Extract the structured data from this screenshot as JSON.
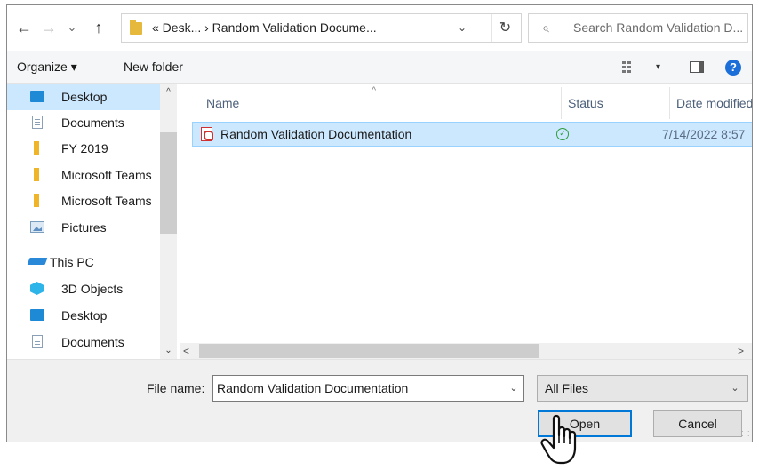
{
  "address": {
    "path": "« Desk... › Random Validation Docume...",
    "back_glyph": "←",
    "forward_glyph": "→",
    "recent_glyph": "⌄",
    "up_glyph": "↑",
    "dropdown_glyph": "⌄",
    "refresh_glyph": "↻"
  },
  "search": {
    "placeholder": "Search Random Validation D...",
    "icon_glyph": "⌕"
  },
  "toolbar": {
    "organize": "Organize ▾",
    "new_folder": "New folder",
    "view_dropdown": "▾",
    "help": "?"
  },
  "nav": {
    "items": [
      {
        "label": "Desktop",
        "icon": "desktop-icon"
      },
      {
        "label": "Documents",
        "icon": "documents-icon"
      },
      {
        "label": "FY 2019",
        "icon": "folder-icon"
      },
      {
        "label": "Microsoft Teams",
        "icon": "folder-icon"
      },
      {
        "label": "Microsoft Teams",
        "icon": "folder-icon"
      },
      {
        "label": "Pictures",
        "icon": "pictures-icon"
      },
      {
        "label": "This PC",
        "icon": "this-pc-icon"
      },
      {
        "label": "3D Objects",
        "icon": "3d-objects-icon"
      },
      {
        "label": "Desktop",
        "icon": "desktop-icon"
      },
      {
        "label": "Documents",
        "icon": "documents-icon"
      }
    ],
    "scroll_up": "^",
    "scroll_down": "⌄"
  },
  "columns": {
    "name": "Name",
    "status": "Status",
    "date_modified": "Date modified",
    "sort_arrow": "^"
  },
  "files": [
    {
      "name": "Random Validation Documentation",
      "status_glyph": "✓",
      "date": "7/14/2022 8:57"
    }
  ],
  "hscroll": {
    "left": "<",
    "right": ">"
  },
  "filename": {
    "label": "File name:",
    "value": "Random Validation Documentation",
    "dropdown_glyph": "⌄"
  },
  "filter": {
    "value": "All Files",
    "dropdown_glyph": "⌄"
  },
  "buttons": {
    "open": "Open",
    "cancel": "Cancel"
  },
  "colors": {
    "selection": "#cce8ff",
    "accent": "#0078d7",
    "help": "#1c6fd9"
  }
}
